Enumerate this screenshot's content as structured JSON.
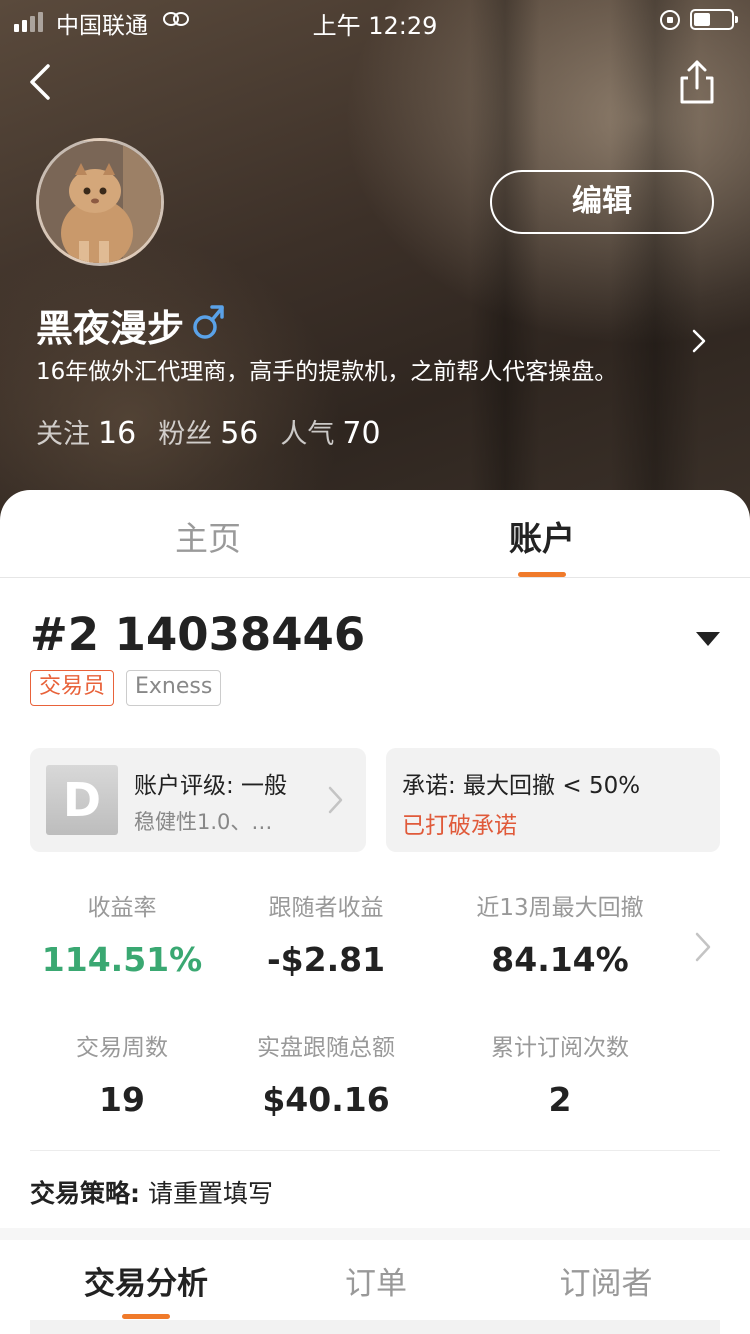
{
  "status_bar": {
    "carrier": "中国联通",
    "time": "上午 12:29"
  },
  "header": {
    "edit_label": "编辑"
  },
  "profile": {
    "name": "黑夜漫步",
    "bio": "16年做外汇代理商，高手的提款机，之前帮人代客操盘。",
    "stats": [
      {
        "label": "关注",
        "value": "16"
      },
      {
        "label": "粉丝",
        "value": "56"
      },
      {
        "label": "人气",
        "value": "70"
      }
    ]
  },
  "tabs": {
    "home": "主页",
    "account": "账户",
    "active": "account"
  },
  "account": {
    "number": "#2 14038446",
    "tags": [
      "交易员",
      "Exness"
    ],
    "rating": {
      "grade": "D",
      "title": "账户评级: 一般",
      "sub": "稳健性1.0、…"
    },
    "promise": {
      "title": "承诺: 最大回撤 < 50%",
      "status": "已打破承诺",
      "status_color": "#e05a3a"
    },
    "metrics": [
      {
        "label": "收益率",
        "value": "114.51%",
        "color": "#3aa872"
      },
      {
        "label": "跟随者收益",
        "value": "-$2.81"
      },
      {
        "label": "近13周最大回撤",
        "value": "84.14%"
      },
      {
        "label": "交易周数",
        "value": "19"
      },
      {
        "label": "实盘跟随总额",
        "value": "$40.16"
      },
      {
        "label": "累计订阅次数",
        "value": "2"
      }
    ],
    "strategy_label": "交易策略:",
    "strategy_value": "请重置填写"
  },
  "sub_tabs": {
    "analysis": "交易分析",
    "orders": "订单",
    "subscribers": "订阅者",
    "active": "analysis"
  },
  "colors": {
    "accent": "#f07a2a",
    "positive": "#3aa872",
    "warning": "#e05a3a"
  },
  "icons": {
    "back": "back-arrow-icon",
    "share": "share-icon",
    "gender": "male-icon",
    "dropdown": "triangle-down-icon",
    "chevron": "chevron-right-icon"
  }
}
